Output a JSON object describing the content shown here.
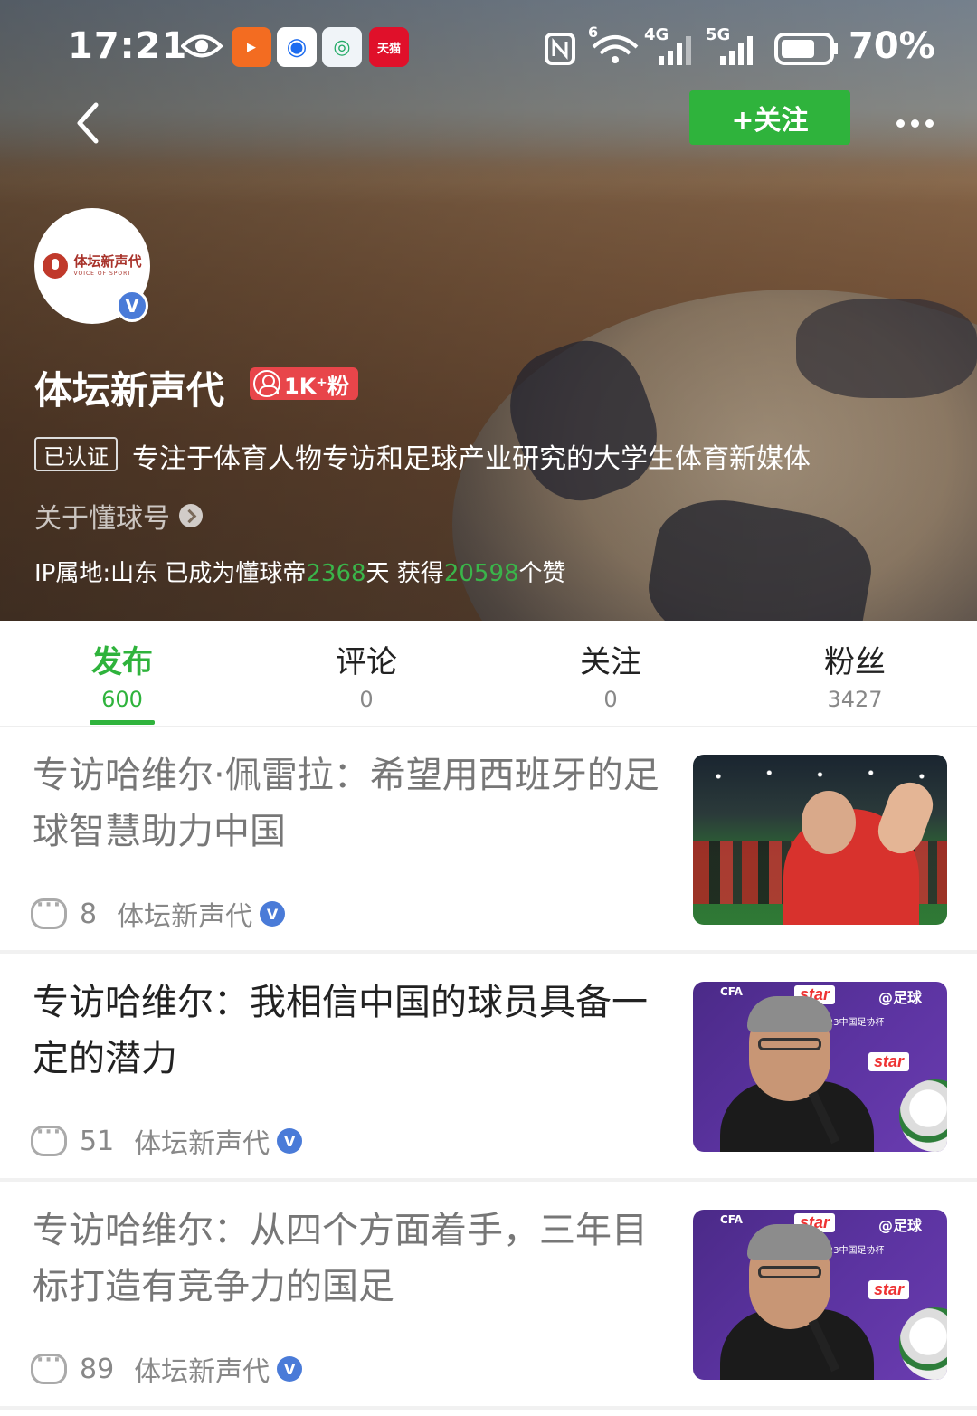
{
  "status_bar": {
    "time": "17:21",
    "battery": "70%",
    "network": [
      "4G",
      "5G"
    ],
    "wifi_label": "6",
    "app_icons": [
      "kuaishou-icon",
      "browser-icon",
      "news-icon",
      "tmall-icon"
    ],
    "tmall_label": "天猫"
  },
  "header": {
    "follow_button": "+关注",
    "back_icon": "back-arrow-icon",
    "more_icon": "more-dots-icon"
  },
  "profile": {
    "avatar_logo_text": "体坛新声代",
    "avatar_logo_sub": "VOICE OF SPORT",
    "name": "体坛新声代",
    "fans_badge": "1K⁺粉",
    "cert_tag": "已认证",
    "bio": "专注于体育人物专访和足球产业研究的大学生体育新媒体",
    "about_link": "关于懂球号",
    "ip_prefix": "IP属地:山东 已成为懂球帝",
    "days": "2368",
    "days_suffix": "天 获得",
    "likes": "20598",
    "likes_suffix": "个赞"
  },
  "tabs": [
    {
      "label": "发布",
      "count": "600",
      "active": true
    },
    {
      "label": "评论",
      "count": "0",
      "active": false
    },
    {
      "label": "关注",
      "count": "0",
      "active": false
    },
    {
      "label": "粉丝",
      "count": "3427",
      "active": false
    }
  ],
  "articles": [
    {
      "title": "专访哈维尔·佩雷拉：希望用西班牙的足球智慧助力中国",
      "comments": "8",
      "author": "体坛新声代",
      "read": true,
      "thumb": "stadium-celebration"
    },
    {
      "title": "专访哈维尔：我相信中国的球员具备一定的潜力",
      "comments": "51",
      "author": "体坛新声代",
      "read": false,
      "thumb": "press-conference"
    },
    {
      "title": "专访哈维尔：从四个方面着手，三年目标打造有竞争力的国足",
      "comments": "89",
      "author": "体坛新声代",
      "read": true,
      "thumb": "press-conference"
    }
  ],
  "thumb_text": {
    "star": "star",
    "cfa": "CFA",
    "cup": "2023中国足协杯",
    "sponsor": "@足球"
  },
  "colors": {
    "accent_green": "#2fb33c",
    "fans_red": "#e8454a",
    "verify_blue": "#4a7bd8"
  }
}
